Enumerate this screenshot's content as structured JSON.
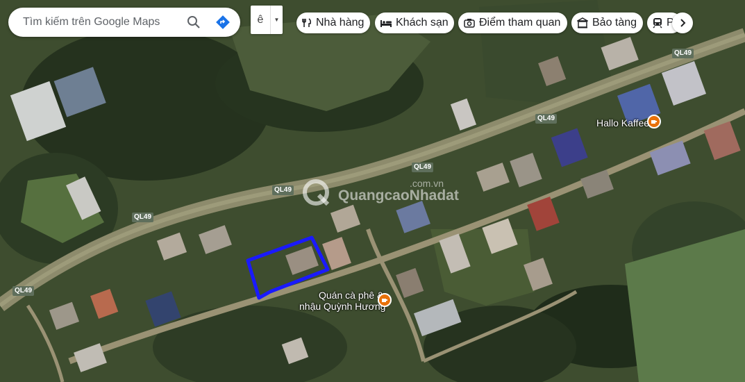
{
  "search": {
    "placeholder": "Tìm kiếm trên Google Maps"
  },
  "ime": {
    "char": "ê"
  },
  "chips": [
    {
      "label": "Nhà hàng",
      "icon": "fork-knife-icon"
    },
    {
      "label": "Khách sạn",
      "icon": "bed-icon"
    },
    {
      "label": "Điểm tham quan",
      "icon": "camera-icon"
    },
    {
      "label": "Bảo tàng",
      "icon": "museum-icon"
    },
    {
      "label": "Ph",
      "icon": "train-icon"
    }
  ],
  "roads": {
    "l1": "QL49",
    "l2": "QL49",
    "l3": "QL49",
    "l4": "QL49",
    "l5": "QL49",
    "l6": "QL49"
  },
  "pois": {
    "cafe1": "Hallo Kaffee",
    "cafe2_line1": "Quán cà phê &",
    "cafe2_line2": "nhậu Quỳnh Hương"
  },
  "watermark": {
    "text": "QuangcaoNhadat",
    "domain": ".com.vn"
  },
  "colors": {
    "parcel_outline": "#1a1aff",
    "poi_pin": "#e8710a",
    "road": "#8a8a6a"
  }
}
